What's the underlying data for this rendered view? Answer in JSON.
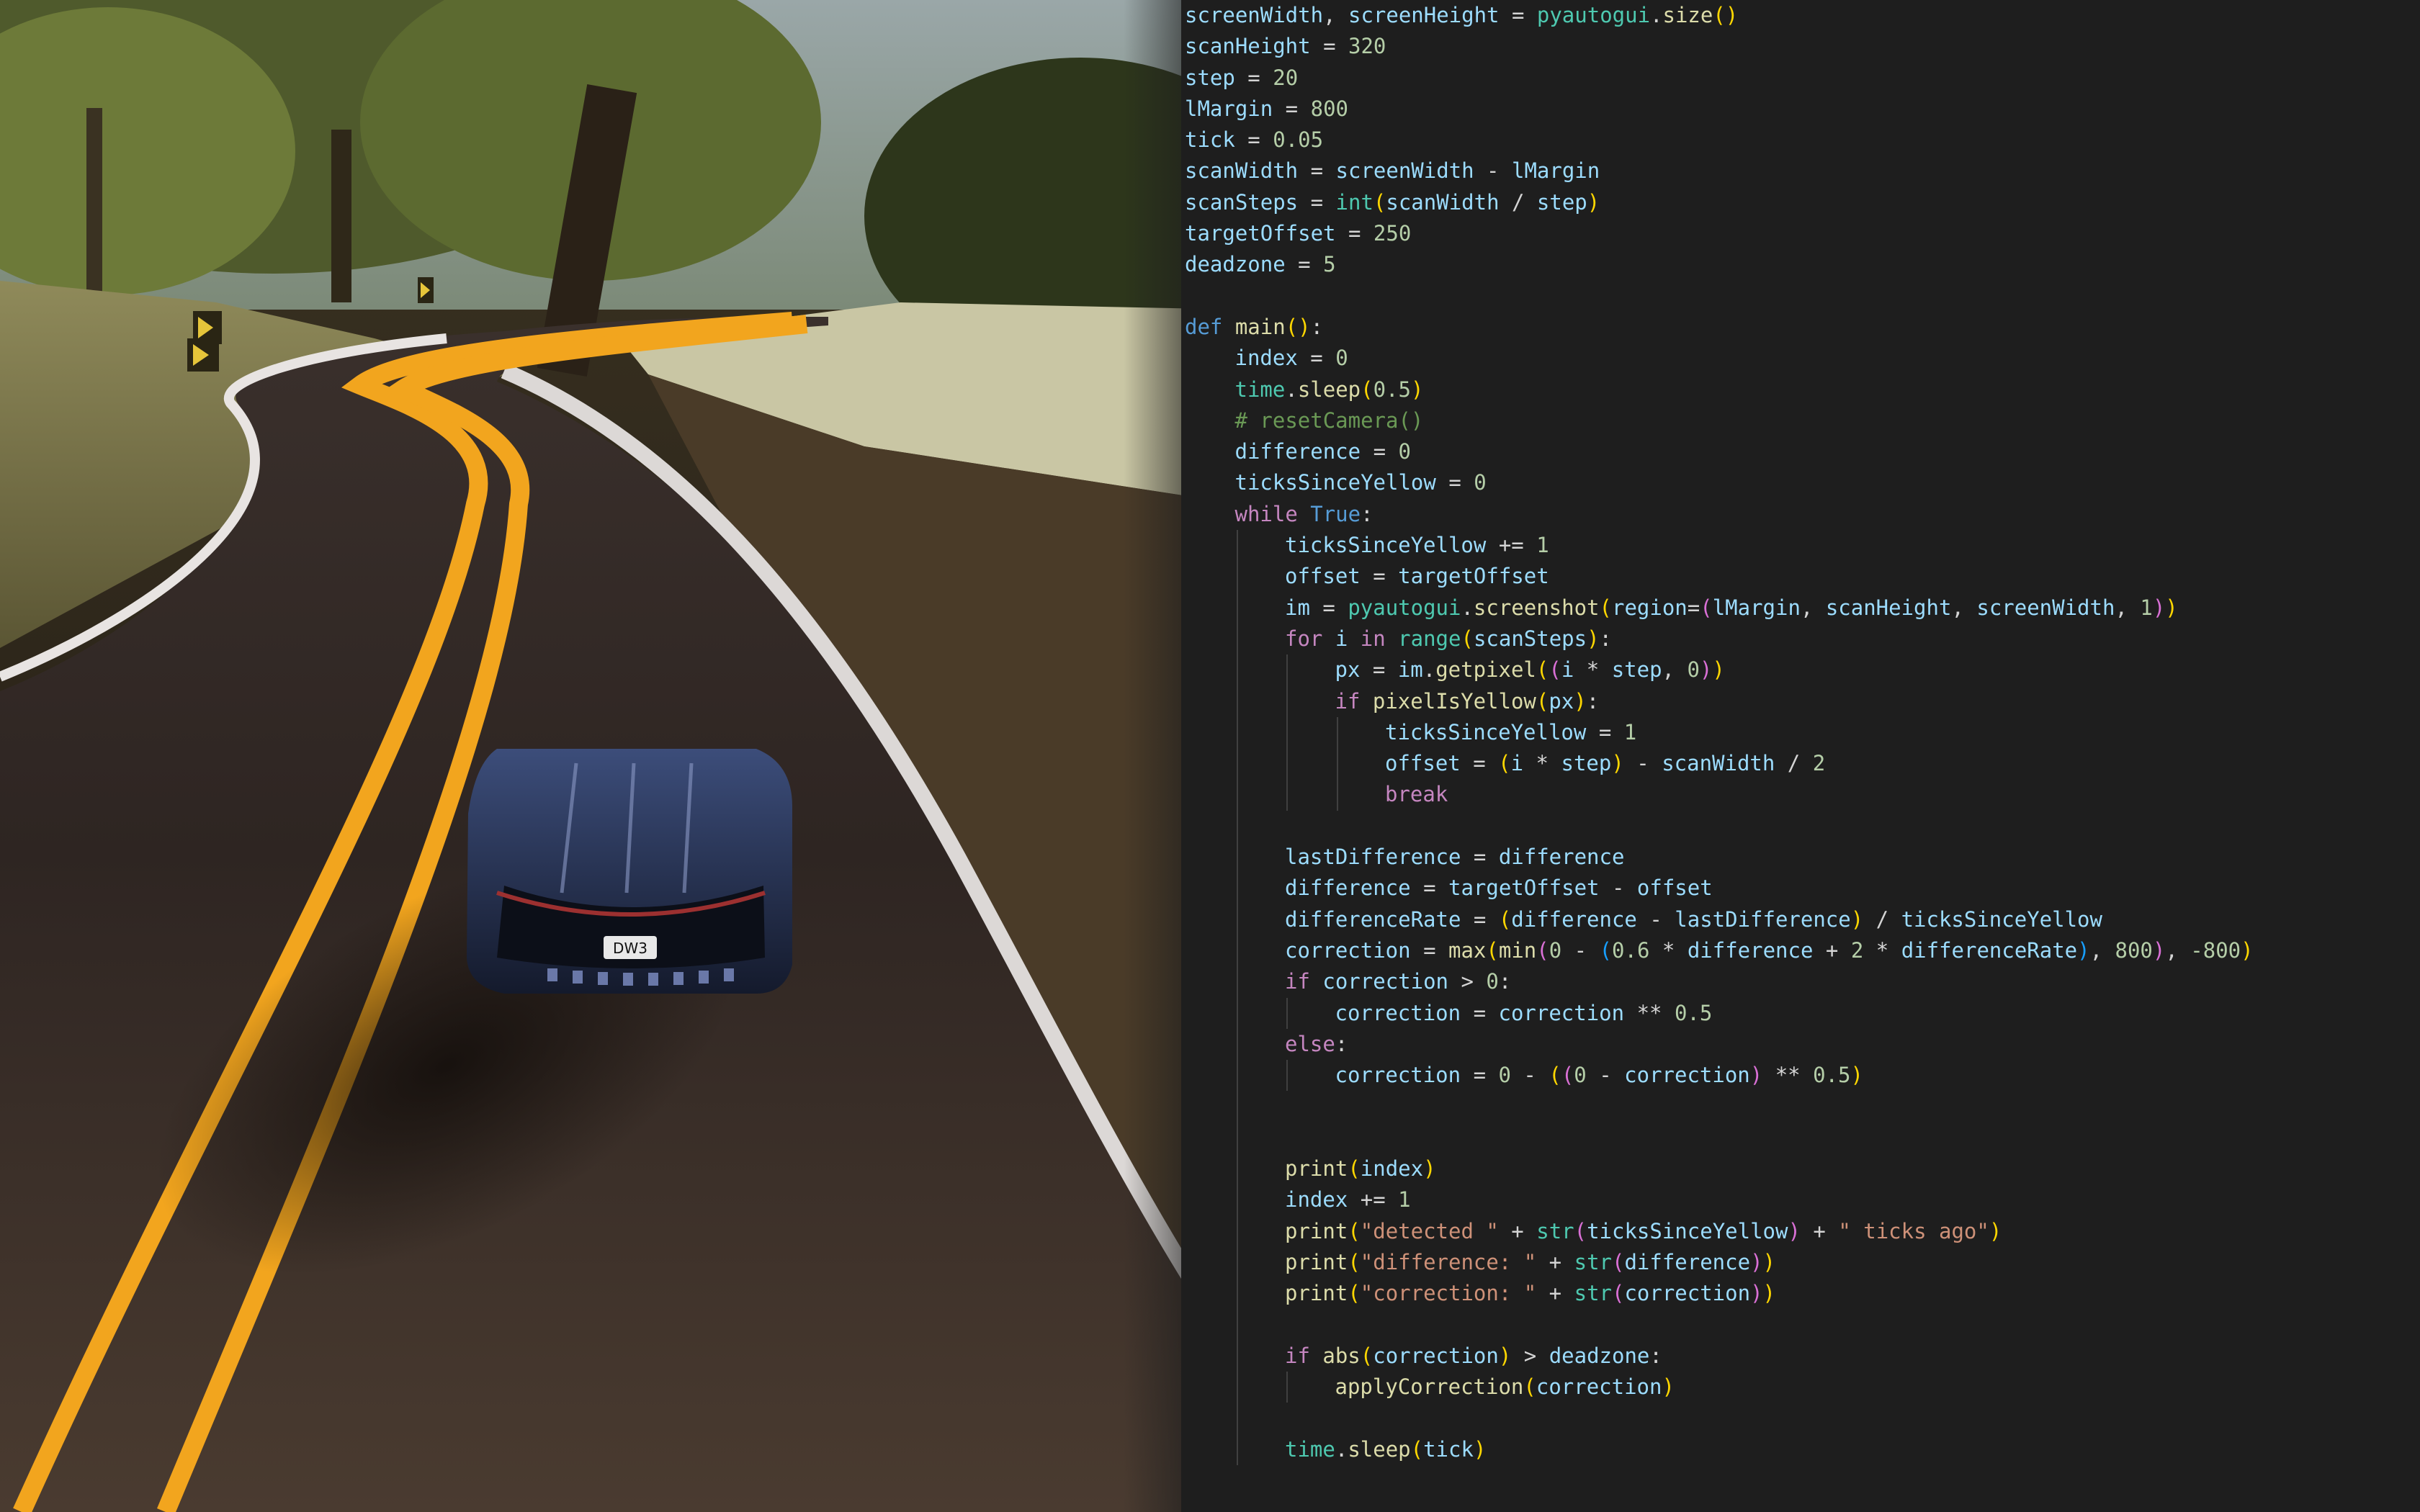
{
  "window": {
    "kind": "game-screenshot-with-code-overlay"
  },
  "game": {
    "license_plate": "DW3"
  },
  "code_lines": [
    {
      "indent": 0,
      "tokens": [
        [
          "var",
          "screenWidth"
        ],
        [
          "plain",
          ", "
        ],
        [
          "var",
          "screenHeight"
        ],
        [
          "plain",
          " = "
        ],
        [
          "bi",
          "pyautogui"
        ],
        [
          "plain",
          "."
        ],
        [
          "fn",
          "size"
        ],
        [
          "br1",
          "()"
        ]
      ]
    },
    {
      "indent": 0,
      "tokens": [
        [
          "var",
          "scanHeight"
        ],
        [
          "plain",
          " = "
        ],
        [
          "num",
          "320"
        ]
      ]
    },
    {
      "indent": 0,
      "tokens": [
        [
          "var",
          "step"
        ],
        [
          "plain",
          " = "
        ],
        [
          "num",
          "20"
        ]
      ]
    },
    {
      "indent": 0,
      "tokens": [
        [
          "var",
          "lMargin"
        ],
        [
          "plain",
          " = "
        ],
        [
          "num",
          "800"
        ]
      ]
    },
    {
      "indent": 0,
      "tokens": [
        [
          "var",
          "tick"
        ],
        [
          "plain",
          " = "
        ],
        [
          "num",
          "0.05"
        ]
      ]
    },
    {
      "indent": 0,
      "tokens": [
        [
          "var",
          "scanWidth"
        ],
        [
          "plain",
          " = "
        ],
        [
          "var",
          "screenWidth"
        ],
        [
          "plain",
          " - "
        ],
        [
          "var",
          "lMargin"
        ]
      ]
    },
    {
      "indent": 0,
      "tokens": [
        [
          "var",
          "scanSteps"
        ],
        [
          "plain",
          " = "
        ],
        [
          "bi",
          "int"
        ],
        [
          "br1",
          "("
        ],
        [
          "var",
          "scanWidth"
        ],
        [
          "plain",
          " / "
        ],
        [
          "var",
          "step"
        ],
        [
          "br1",
          ")"
        ]
      ]
    },
    {
      "indent": 0,
      "tokens": [
        [
          "var",
          "targetOffset"
        ],
        [
          "plain",
          " = "
        ],
        [
          "num",
          "250"
        ]
      ]
    },
    {
      "indent": 0,
      "tokens": [
        [
          "var",
          "deadzone"
        ],
        [
          "plain",
          " = "
        ],
        [
          "num",
          "5"
        ]
      ]
    },
    {
      "indent": 0,
      "tokens": []
    },
    {
      "indent": 0,
      "tokens": [
        [
          "kw",
          "def "
        ],
        [
          "fn",
          "main"
        ],
        [
          "br1",
          "()"
        ],
        [
          "plain",
          ":"
        ]
      ]
    },
    {
      "indent": 1,
      "tokens": [
        [
          "var",
          "index"
        ],
        [
          "plain",
          " = "
        ],
        [
          "num",
          "0"
        ]
      ]
    },
    {
      "indent": 1,
      "tokens": [
        [
          "bi",
          "time"
        ],
        [
          "plain",
          "."
        ],
        [
          "fn",
          "sleep"
        ],
        [
          "br1",
          "("
        ],
        [
          "num",
          "0.5"
        ],
        [
          "br1",
          ")"
        ]
      ]
    },
    {
      "indent": 1,
      "tokens": [
        [
          "cm",
          "# resetCamera()"
        ]
      ]
    },
    {
      "indent": 1,
      "tokens": [
        [
          "var",
          "difference"
        ],
        [
          "plain",
          " = "
        ],
        [
          "num",
          "0"
        ]
      ]
    },
    {
      "indent": 1,
      "tokens": [
        [
          "var",
          "ticksSinceYellow"
        ],
        [
          "plain",
          " = "
        ],
        [
          "num",
          "0"
        ]
      ]
    },
    {
      "indent": 1,
      "tokens": [
        [
          "ctl",
          "while "
        ],
        [
          "kw",
          "True"
        ],
        [
          "plain",
          ":"
        ]
      ]
    },
    {
      "indent": 2,
      "tokens": [
        [
          "var",
          "ticksSinceYellow"
        ],
        [
          "plain",
          " += "
        ],
        [
          "num",
          "1"
        ]
      ]
    },
    {
      "indent": 2,
      "tokens": [
        [
          "var",
          "offset"
        ],
        [
          "plain",
          " = "
        ],
        [
          "var",
          "targetOffset"
        ]
      ]
    },
    {
      "indent": 2,
      "tokens": [
        [
          "var",
          "im"
        ],
        [
          "plain",
          " = "
        ],
        [
          "bi",
          "pyautogui"
        ],
        [
          "plain",
          "."
        ],
        [
          "fn",
          "screenshot"
        ],
        [
          "br1",
          "("
        ],
        [
          "var",
          "region"
        ],
        [
          "plain",
          "="
        ],
        [
          "br2",
          "("
        ],
        [
          "var",
          "lMargin"
        ],
        [
          "plain",
          ", "
        ],
        [
          "var",
          "scanHeight"
        ],
        [
          "plain",
          ", "
        ],
        [
          "var",
          "screenWidth"
        ],
        [
          "plain",
          ", "
        ],
        [
          "num",
          "1"
        ],
        [
          "br2",
          ")"
        ],
        [
          "br1",
          ")"
        ]
      ]
    },
    {
      "indent": 2,
      "tokens": [
        [
          "ctl",
          "for "
        ],
        [
          "var",
          "i"
        ],
        [
          "ctl",
          " in "
        ],
        [
          "bi",
          "range"
        ],
        [
          "br1",
          "("
        ],
        [
          "var",
          "scanSteps"
        ],
        [
          "br1",
          ")"
        ],
        [
          "plain",
          ":"
        ]
      ]
    },
    {
      "indent": 3,
      "tokens": [
        [
          "var",
          "px"
        ],
        [
          "plain",
          " = "
        ],
        [
          "var",
          "im"
        ],
        [
          "plain",
          "."
        ],
        [
          "fn",
          "getpixel"
        ],
        [
          "br1",
          "("
        ],
        [
          "br2",
          "("
        ],
        [
          "var",
          "i"
        ],
        [
          "plain",
          " * "
        ],
        [
          "var",
          "step"
        ],
        [
          "plain",
          ", "
        ],
        [
          "num",
          "0"
        ],
        [
          "br2",
          ")"
        ],
        [
          "br1",
          ")"
        ]
      ]
    },
    {
      "indent": 3,
      "tokens": [
        [
          "ctl",
          "if "
        ],
        [
          "fn",
          "pixelIsYellow"
        ],
        [
          "br1",
          "("
        ],
        [
          "var",
          "px"
        ],
        [
          "br1",
          ")"
        ],
        [
          "plain",
          ":"
        ]
      ]
    },
    {
      "indent": 4,
      "tokens": [
        [
          "var",
          "ticksSinceYellow"
        ],
        [
          "plain",
          " = "
        ],
        [
          "num",
          "1"
        ]
      ]
    },
    {
      "indent": 4,
      "tokens": [
        [
          "var",
          "offset"
        ],
        [
          "plain",
          " = "
        ],
        [
          "br1",
          "("
        ],
        [
          "var",
          "i"
        ],
        [
          "plain",
          " * "
        ],
        [
          "var",
          "step"
        ],
        [
          "br1",
          ")"
        ],
        [
          "plain",
          " - "
        ],
        [
          "var",
          "scanWidth"
        ],
        [
          "plain",
          " / "
        ],
        [
          "num",
          "2"
        ]
      ]
    },
    {
      "indent": 4,
      "tokens": [
        [
          "ctl",
          "break"
        ]
      ]
    },
    {
      "indent": 2,
      "tokens": []
    },
    {
      "indent": 2,
      "tokens": [
        [
          "var",
          "lastDifference"
        ],
        [
          "plain",
          " = "
        ],
        [
          "var",
          "difference"
        ]
      ]
    },
    {
      "indent": 2,
      "tokens": [
        [
          "var",
          "difference"
        ],
        [
          "plain",
          " = "
        ],
        [
          "var",
          "targetOffset"
        ],
        [
          "plain",
          " - "
        ],
        [
          "var",
          "offset"
        ]
      ]
    },
    {
      "indent": 2,
      "tokens": [
        [
          "var",
          "differenceRate"
        ],
        [
          "plain",
          " = "
        ],
        [
          "br1",
          "("
        ],
        [
          "var",
          "difference"
        ],
        [
          "plain",
          " - "
        ],
        [
          "var",
          "lastDifference"
        ],
        [
          "br1",
          ")"
        ],
        [
          "plain",
          " / "
        ],
        [
          "var",
          "ticksSinceYellow"
        ]
      ]
    },
    {
      "indent": 2,
      "tokens": [
        [
          "var",
          "correction"
        ],
        [
          "plain",
          " = "
        ],
        [
          "fn",
          "max"
        ],
        [
          "br1",
          "("
        ],
        [
          "fn",
          "min"
        ],
        [
          "br2",
          "("
        ],
        [
          "num",
          "0"
        ],
        [
          "plain",
          " - "
        ],
        [
          "br3",
          "("
        ],
        [
          "num",
          "0.6"
        ],
        [
          "plain",
          " * "
        ],
        [
          "var",
          "difference"
        ],
        [
          "plain",
          " + "
        ],
        [
          "num",
          "2"
        ],
        [
          "plain",
          " * "
        ],
        [
          "var",
          "differenceRate"
        ],
        [
          "br3",
          ")"
        ],
        [
          "plain",
          ", "
        ],
        [
          "num",
          "800"
        ],
        [
          "br2",
          ")"
        ],
        [
          "plain",
          ", "
        ],
        [
          "num",
          "-800"
        ],
        [
          "br1",
          ")"
        ]
      ]
    },
    {
      "indent": 2,
      "tokens": [
        [
          "ctl",
          "if "
        ],
        [
          "var",
          "correction"
        ],
        [
          "plain",
          " > "
        ],
        [
          "num",
          "0"
        ],
        [
          "plain",
          ":"
        ]
      ]
    },
    {
      "indent": 3,
      "tokens": [
        [
          "var",
          "correction"
        ],
        [
          "plain",
          " = "
        ],
        [
          "var",
          "correction"
        ],
        [
          "plain",
          " ** "
        ],
        [
          "num",
          "0.5"
        ]
      ]
    },
    {
      "indent": 2,
      "tokens": [
        [
          "ctl",
          "else"
        ],
        [
          "plain",
          ":"
        ]
      ]
    },
    {
      "indent": 3,
      "tokens": [
        [
          "var",
          "correction"
        ],
        [
          "plain",
          " = "
        ],
        [
          "num",
          "0"
        ],
        [
          "plain",
          " - "
        ],
        [
          "br1",
          "("
        ],
        [
          "br2",
          "("
        ],
        [
          "num",
          "0"
        ],
        [
          "plain",
          " - "
        ],
        [
          "var",
          "correction"
        ],
        [
          "br2",
          ")"
        ],
        [
          "plain",
          " ** "
        ],
        [
          "num",
          "0.5"
        ],
        [
          "br1",
          ")"
        ]
      ]
    },
    {
      "indent": 2,
      "tokens": []
    },
    {
      "indent": 2,
      "tokens": []
    },
    {
      "indent": 2,
      "tokens": [
        [
          "fn",
          "print"
        ],
        [
          "br1",
          "("
        ],
        [
          "var",
          "index"
        ],
        [
          "br1",
          ")"
        ]
      ]
    },
    {
      "indent": 2,
      "tokens": [
        [
          "var",
          "index"
        ],
        [
          "plain",
          " += "
        ],
        [
          "num",
          "1"
        ]
      ]
    },
    {
      "indent": 2,
      "tokens": [
        [
          "fn",
          "print"
        ],
        [
          "br1",
          "("
        ],
        [
          "str",
          "\"detected \""
        ],
        [
          "plain",
          " + "
        ],
        [
          "bi",
          "str"
        ],
        [
          "br2",
          "("
        ],
        [
          "var",
          "ticksSinceYellow"
        ],
        [
          "br2",
          ")"
        ],
        [
          "plain",
          " + "
        ],
        [
          "str",
          "\" ticks ago\""
        ],
        [
          "br1",
          ")"
        ]
      ]
    },
    {
      "indent": 2,
      "tokens": [
        [
          "fn",
          "print"
        ],
        [
          "br1",
          "("
        ],
        [
          "str",
          "\"difference: \""
        ],
        [
          "plain",
          " + "
        ],
        [
          "bi",
          "str"
        ],
        [
          "br2",
          "("
        ],
        [
          "var",
          "difference"
        ],
        [
          "br2",
          ")"
        ],
        [
          "br1",
          ")"
        ]
      ]
    },
    {
      "indent": 2,
      "tokens": [
        [
          "fn",
          "print"
        ],
        [
          "br1",
          "("
        ],
        [
          "str",
          "\"correction: \""
        ],
        [
          "plain",
          " + "
        ],
        [
          "bi",
          "str"
        ],
        [
          "br2",
          "("
        ],
        [
          "var",
          "correction"
        ],
        [
          "br2",
          ")"
        ],
        [
          "br1",
          ")"
        ]
      ]
    },
    {
      "indent": 2,
      "tokens": []
    },
    {
      "indent": 2,
      "tokens": [
        [
          "ctl",
          "if "
        ],
        [
          "fn",
          "abs"
        ],
        [
          "br1",
          "("
        ],
        [
          "var",
          "correction"
        ],
        [
          "br1",
          ")"
        ],
        [
          "plain",
          " > "
        ],
        [
          "var",
          "deadzone"
        ],
        [
          "plain",
          ":"
        ]
      ]
    },
    {
      "indent": 3,
      "tokens": [
        [
          "fn",
          "applyCorrection"
        ],
        [
          "br1",
          "("
        ],
        [
          "var",
          "correction"
        ],
        [
          "br1",
          ")"
        ]
      ]
    },
    {
      "indent": 2,
      "tokens": []
    },
    {
      "indent": 2,
      "tokens": [
        [
          "bi",
          "time"
        ],
        [
          "plain",
          "."
        ],
        [
          "fn",
          "sleep"
        ],
        [
          "br1",
          "("
        ],
        [
          "var",
          "tick"
        ],
        [
          "br1",
          ")"
        ]
      ]
    }
  ]
}
